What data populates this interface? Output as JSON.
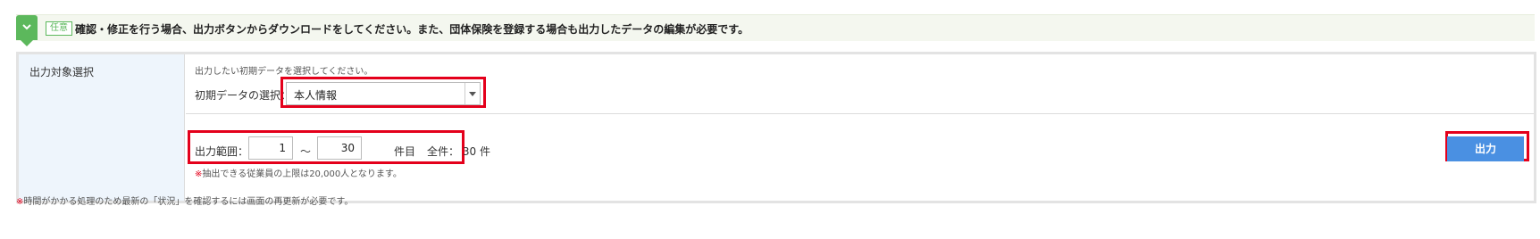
{
  "banner": {
    "badge": "任意",
    "text": "確認・修正を行う場合、出力ボタンからダウンロードをしてください。また、団体保険を登録する場合も出力したデータの編集が必要です。"
  },
  "form": {
    "row_label": "出力対象選択",
    "hint": "出力したい初期データを選択してください。",
    "select_label": "初期データの選択：",
    "select_value": "本人情報",
    "range_label": "出力範囲：",
    "range_from": "1",
    "range_tilde": "～",
    "range_to": "30",
    "range_unit": "件目",
    "total_label": "全件：",
    "total_value": "30",
    "total_unit": "件",
    "note_mark": "※",
    "note_text": "抽出できる従業員の上限は20,000人となります。",
    "output_button": "出力"
  },
  "footer": {
    "mark": "※",
    "text": "時間がかかる処理のため最新の「状況」を確認するには画面の再更新が必要です。"
  },
  "colors": {
    "accent_green": "#5cb85c",
    "button_blue": "#4a90e2",
    "highlight_red": "#e4001b",
    "label_bg": "#eef5fc"
  },
  "icons": {
    "banner_toggle": "chevron-down-icon",
    "select_arrow": "caret-down-icon"
  }
}
